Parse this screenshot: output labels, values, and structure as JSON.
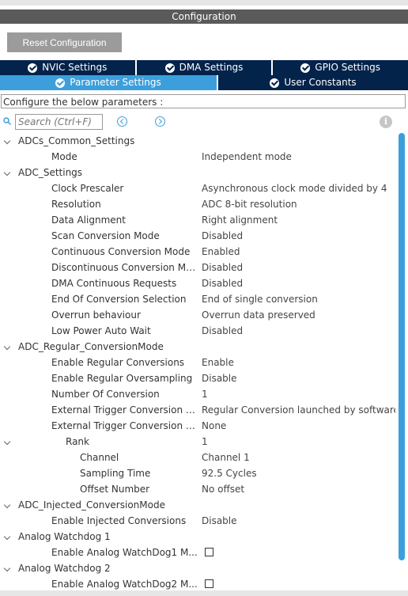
{
  "window": {
    "title": "Configuration"
  },
  "toolbar": {
    "reset_label": "Reset Configuration"
  },
  "tabs_row1": [
    {
      "label": "NVIC Settings"
    },
    {
      "label": "DMA Settings"
    },
    {
      "label": "GPIO Settings"
    }
  ],
  "tabs_row2": [
    {
      "label": "Parameter Settings",
      "active": true
    },
    {
      "label": "User Constants"
    }
  ],
  "description": "Configure the below parameters :",
  "search": {
    "placeholder": "Search (Ctrl+F)"
  },
  "tree": [
    {
      "label": "ADCs_Common_Settings",
      "level": 0,
      "group": true
    },
    {
      "label": "Mode",
      "value": "Independent mode",
      "level": 1
    },
    {
      "label": "ADC_Settings",
      "level": 0,
      "group": true
    },
    {
      "label": "Clock Prescaler",
      "value": "Asynchronous clock mode divided by 4",
      "level": 1
    },
    {
      "label": "Resolution",
      "value": "ADC 8-bit resolution",
      "level": 1
    },
    {
      "label": "Data Alignment",
      "value": "Right alignment",
      "level": 1
    },
    {
      "label": "Scan Conversion Mode",
      "value": "Disabled",
      "level": 1
    },
    {
      "label": "Continuous Conversion Mode",
      "value": "Enabled",
      "level": 1
    },
    {
      "label": "Discontinuous Conversion Mode",
      "value": "Disabled",
      "level": 1
    },
    {
      "label": "DMA Continuous Requests",
      "value": "Disabled",
      "level": 1
    },
    {
      "label": "End Of Conversion Selection",
      "value": "End of single conversion",
      "level": 1
    },
    {
      "label": "Overrun behaviour",
      "value": "Overrun data preserved",
      "level": 1
    },
    {
      "label": "Low Power Auto Wait",
      "value": "Disabled",
      "level": 1
    },
    {
      "label": "ADC_Regular_ConversionMode",
      "level": 0,
      "group": true
    },
    {
      "label": "Enable Regular Conversions",
      "value": "Enable",
      "level": 1
    },
    {
      "label": "Enable Regular Oversampling",
      "value": "Disable",
      "level": 1
    },
    {
      "label": "Number Of Conversion",
      "value": "1",
      "level": 1
    },
    {
      "label": "External Trigger Conversion S...",
      "value": "Regular Conversion launched by software",
      "level": 1
    },
    {
      "label": "External Trigger Conversion E...",
      "value": "None",
      "level": 1
    },
    {
      "label": "Rank",
      "value": "1",
      "level": 2,
      "group": true
    },
    {
      "label": "Channel",
      "value": "Channel 1",
      "level": 3
    },
    {
      "label": "Sampling Time",
      "value": "92.5 Cycles",
      "level": 3
    },
    {
      "label": "Offset Number",
      "value": "No offset",
      "level": 3
    },
    {
      "label": "ADC_Injected_ConversionMode",
      "level": 0,
      "group": true
    },
    {
      "label": "Enable Injected Conversions",
      "value": "Disable",
      "level": 1
    },
    {
      "label": "Analog Watchdog 1",
      "level": 0,
      "group": true
    },
    {
      "label": "Enable Analog WatchDog1 M...",
      "checkbox": false,
      "level": 1
    },
    {
      "label": "Analog Watchdog 2",
      "level": 0,
      "group": true
    },
    {
      "label": "Enable Analog WatchDog2 M...",
      "checkbox": false,
      "level": 1
    }
  ],
  "colors": {
    "tab_dark": "#03234b",
    "tab_active": "#3c9fdc",
    "title_bg": "#5a5a5a"
  },
  "icons": {
    "search": "search-icon",
    "prev": "prev-icon",
    "next": "next-icon",
    "info": "info-icon",
    "tab_check": "check-circle-icon"
  }
}
